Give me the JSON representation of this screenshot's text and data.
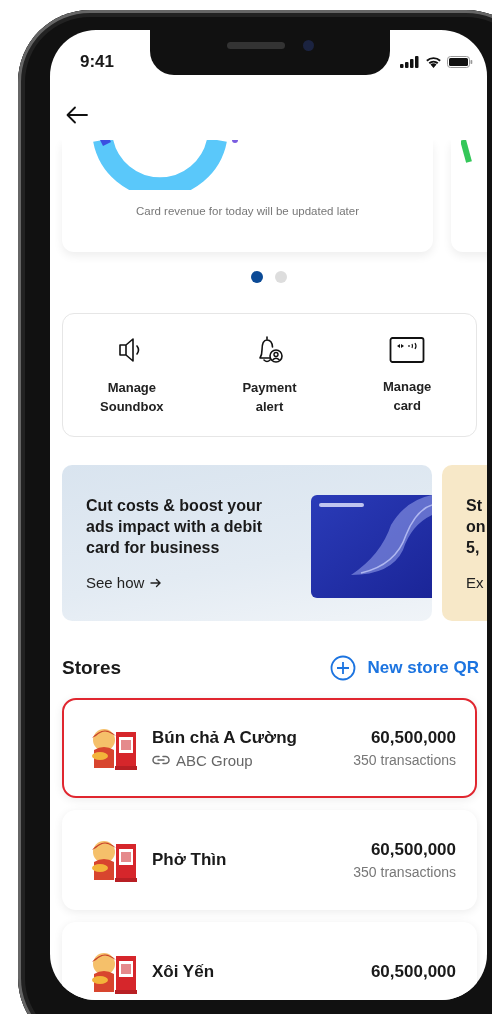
{
  "status_bar": {
    "time": "9:41"
  },
  "revenue_card": {
    "caption": "Card revenue for today will be updated later"
  },
  "carousel_dots": [
    {
      "selected": true
    },
    {
      "selected": false
    }
  ],
  "quick_actions": [
    {
      "kind": "soundbox",
      "label": "Manage Soundbox"
    },
    {
      "kind": "alert",
      "label": "Payment alert"
    },
    {
      "kind": "card",
      "label": "Manage card"
    }
  ],
  "promos": [
    {
      "kind": "debit-card",
      "title": "Cut costs & boost your ads impact with a debit card for business",
      "link": "See how"
    },
    {
      "kind": "partial",
      "title": "St on 5,",
      "link": "Ex"
    }
  ],
  "stores": {
    "title": "Stores",
    "new_button": "New store QR",
    "items": [
      {
        "name": "Bún chả A Cường",
        "group": "ABC Group",
        "amount": "60,500,000",
        "transactions": "350 transactions",
        "highlighted": true
      },
      {
        "name": "Phở Thìn",
        "amount": "60,500,000",
        "transactions": "350 transactions",
        "highlighted": false
      },
      {
        "name": "Xôi Yến",
        "amount": "60,500,000",
        "highlighted": false
      }
    ]
  }
}
